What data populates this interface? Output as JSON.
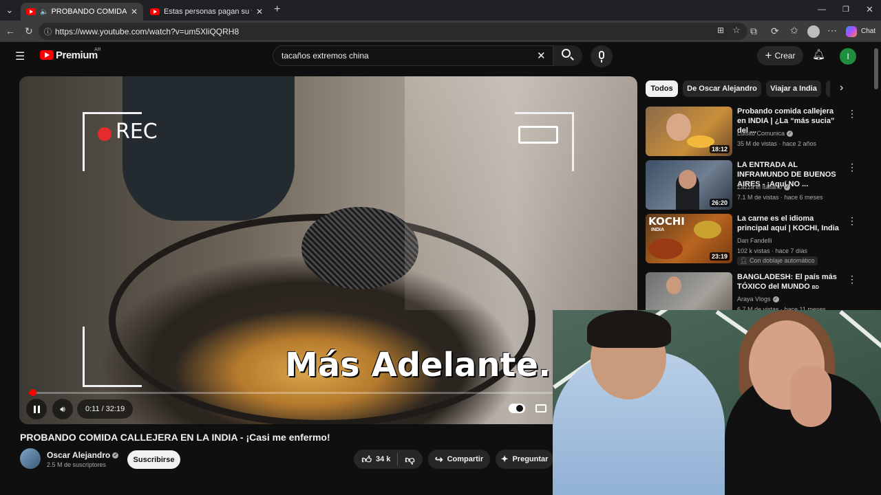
{
  "browser": {
    "tabs": [
      {
        "label": "PROBANDO COMIDA CALLEJERA EN LA INDIA",
        "active": true
      },
      {
        "label": "Estas personas pagan su vida con",
        "active": false
      }
    ],
    "url": "https://www.youtube.com/watch?v=um5XliQQRH8",
    "chat_label": "Chat"
  },
  "yt_header": {
    "logo_text": "Premium",
    "logo_region": "AR",
    "search_query": "tacaños extremos china",
    "create_label": "Crear",
    "avatar_letter": "I"
  },
  "player": {
    "overlay_rec": "REC",
    "caption": "Más Adelante...",
    "current_time": "0:11",
    "separator": "/",
    "duration": "32:19",
    "progress_fraction": 0.0057
  },
  "video": {
    "title": "PROBANDO COMIDA CALLEJERA EN LA INDIA - ¡Casi me enfermo!",
    "channel": "Oscar Alejandro",
    "subscribers": "2.5 M de suscriptores",
    "subscribe_label": "Suscribirse",
    "likes": "34 k",
    "share_label": "Compartir",
    "ask_label": "Preguntar"
  },
  "sidebar": {
    "chips": [
      {
        "label": "Todos",
        "active": true
      },
      {
        "label": "De Oscar Alejandro",
        "active": false
      },
      {
        "label": "Viajar a India",
        "active": false
      }
    ],
    "recommendations": [
      {
        "title": "Probando comida callejera en INDIA | ¿La “más sucia” del ...",
        "channel": "Luisito Comunica",
        "verified": true,
        "meta": "35 M de vistas · hace 2 años",
        "duration": "18:12",
        "thumb_color_a": "#8a6a4a",
        "thumb_color_b": "#c98f3a"
      },
      {
        "title": "LA ENTRADA AL INFRAMUNDO DE BUENOS AIRES - ¡Aquí NO ...",
        "channel": "Zazza el italiano",
        "verified": true,
        "meta": "7.1 M de vistas · hace 6 meses",
        "duration": "26:20",
        "thumb_color_a": "#3e4f66",
        "thumb_color_b": "#6f7e90"
      },
      {
        "title": "La carne es el idioma principal aquí | KOCHI, India",
        "channel": "Dan Fandelli",
        "verified": false,
        "meta": "102 k vistas · hace 7 días",
        "duration": "23:19",
        "badge": "Con doblaje automático",
        "thumb_text": "KOCHI",
        "thumb_subtext": "INDIA",
        "thumb_color_a": "#5a3a1c",
        "thumb_color_b": "#b8651f"
      },
      {
        "title": "BANGLADESH: El país más TÓXICO del MUNDO",
        "title_suffix": "BD",
        "channel": "Araya Vlogs",
        "verified": true,
        "meta": "6.7 M de vistas · hace 11 meses",
        "thumb_color_a": "#6d6f72",
        "thumb_color_b": "#a4a19b"
      }
    ]
  },
  "colors": {
    "background": "#0f0f0f",
    "accent_red": "#ff0000",
    "chip_bg": "#272727",
    "text_secondary": "#aaaaaa"
  }
}
